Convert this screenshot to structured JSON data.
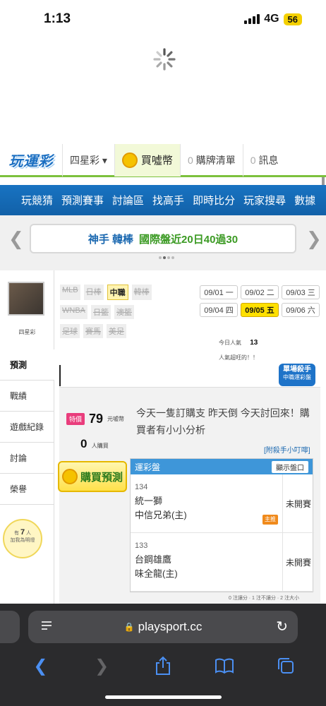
{
  "status": {
    "time": "1:13",
    "network": "4G",
    "battery": "56"
  },
  "header": {
    "logo": "玩運彩",
    "lottery": "四星彩 ▾",
    "coin": "買噓幣",
    "cart_count": "0",
    "cart": "購牌清單",
    "msg_count": "0",
    "msg": "訊息"
  },
  "nav": [
    "玩競猜",
    "預測賽事",
    "討論區",
    "找高手",
    "即時比分",
    "玩家搜尋",
    "數據"
  ],
  "banner": {
    "name": "神手 韓棒",
    "text": "國際盤近20日40過30"
  },
  "profile": {
    "nickname": "四星彩"
  },
  "left_menu": [
    "預測",
    "戰績",
    "遊戲紀錄",
    "討論",
    "榮譽"
  ],
  "hint": {
    "prefix": "有",
    "count": "7",
    "suffix": "人",
    "line2": "加我為明燈"
  },
  "filters": [
    [
      "MLB",
      "日棒",
      "中職",
      "韓棒"
    ],
    [
      "WNBA",
      "日籃",
      "澳籃"
    ],
    [
      "足球",
      "賽馬",
      "美足"
    ]
  ],
  "active_filter": "中職",
  "dates": [
    "09/01 一",
    "09/02 二",
    "09/03 三",
    "09/04 四",
    "09/05 五",
    "09/06 六"
  ],
  "active_date": "09/05 五",
  "popularity": {
    "label": "今日人氣",
    "value": "13",
    "note": "人氣超旺的！！"
  },
  "badge": {
    "title": "單場殺手",
    "sub": "中職運彩盤"
  },
  "predict": {
    "tag": "特價",
    "price": "79",
    "unit": "元噓幣",
    "buyers": "0",
    "buyers_unit": "人購買",
    "buy_label": "購買預測",
    "note": "今天一隻訂購支 昨天倒 今天討回來！購買者有小小分析",
    "attach_link": "[附殺手小叮嚀]"
  },
  "board": {
    "title": "運彩盤",
    "button": "顯示盤口",
    "games": [
      {
        "id": "134",
        "away": "統一獅",
        "home": "中信兄弟(主)",
        "pick": "主推",
        "status": "未開賽"
      },
      {
        "id": "133",
        "away": "台鋼雄鷹",
        "home": "味全龍(主)",
        "pick": "",
        "status": "未開賽"
      }
    ],
    "legend": "0 注讓分 · 1 注不讓分 · 2 注大小"
  },
  "browser": {
    "url": "playsport.cc",
    "lock": "🔒"
  }
}
